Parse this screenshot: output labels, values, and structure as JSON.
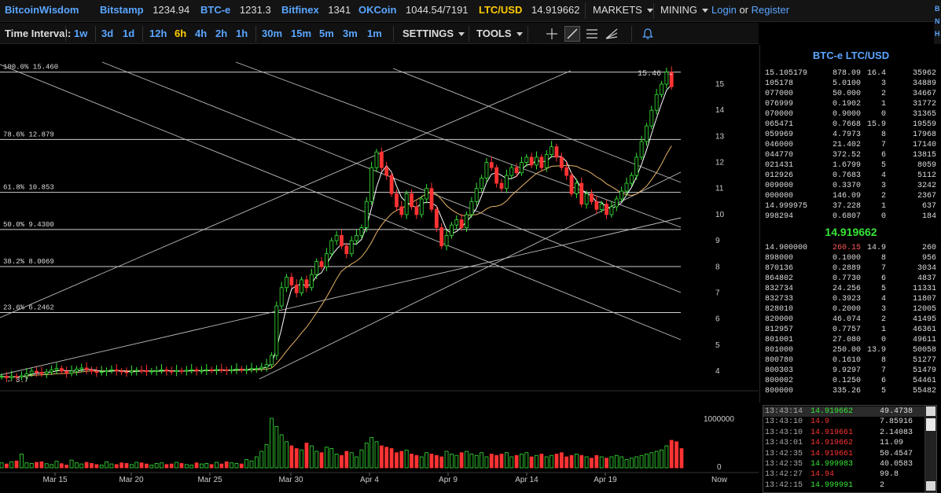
{
  "app": {
    "logo": "BitcoinWisdom"
  },
  "tickers": [
    {
      "exchange": "Bitstamp",
      "price": "1234.94"
    },
    {
      "exchange": "BTC-e",
      "price": "1231.3"
    },
    {
      "exchange": "Bitfinex",
      "price": "1341"
    },
    {
      "exchange": "OKCoin",
      "price": "1044.54/7191"
    },
    {
      "exchange": "LTC/USD",
      "price": "14.919662"
    }
  ],
  "topnav": {
    "markets": "MARKETS",
    "mining": "MINING",
    "login": "Login",
    "or": "or",
    "register": "Register"
  },
  "edge_letters": [
    "B",
    "N",
    "H"
  ],
  "toolbar": {
    "time_interval_label": "Time Interval:",
    "intervals": [
      "1w",
      "3d",
      "1d",
      "12h",
      "6h",
      "4h",
      "2h",
      "1h",
      "30m",
      "15m",
      "5m",
      "3m",
      "1m"
    ],
    "active_interval": "6h",
    "settings": "SETTINGS",
    "tools": "TOOLS",
    "tool_icons": [
      "crosshair-icon",
      "line-tool-icon",
      "horizontal-lines-icon",
      "fan-tool-icon",
      "bell-icon"
    ]
  },
  "colors": {
    "up": "#37e637",
    "down": "#ff3333",
    "link": "#5aa6ff",
    "pair": "#ffcc00"
  },
  "chart_data": {
    "type": "candlestick",
    "y_ticks": [
      4,
      5,
      6,
      7,
      8,
      9,
      10,
      11,
      12,
      13,
      14,
      15
    ],
    "ylim": [
      3.0,
      15.9
    ],
    "x_ticks": [
      "Mar 15",
      "Mar 20",
      "Mar 25",
      "Mar 30",
      "Apr 4",
      "Apr 9",
      "Apr 14",
      "Apr 19",
      "Now"
    ],
    "fib_levels": [
      {
        "label": "100.0% 15.460",
        "value": 15.46
      },
      {
        "label": "78.6% 12.879",
        "value": 12.879
      },
      {
        "label": "61.8% 10.853",
        "value": 10.853
      },
      {
        "label": "50.0% 9.4300",
        "value": 9.43
      },
      {
        "label": "38.2% 8.0069",
        "value": 8.0069
      },
      {
        "label": "23.6% 6.2462",
        "value": 6.2462
      }
    ],
    "high_marker": "15.46",
    "low_marker": "3.7",
    "volume_tick": "1000000",
    "volume_zero": "0",
    "closes": [
      3.8,
      3.75,
      3.8,
      3.78,
      3.82,
      3.9,
      4.0,
      3.95,
      3.9,
      3.97,
      4.05,
      4.1,
      4.0,
      3.92,
      4.0,
      4.08,
      4.12,
      4.05,
      4.0,
      3.95,
      3.98,
      4.02,
      4.05,
      4.0,
      3.97,
      3.95,
      4.0,
      4.03,
      4.02,
      3.98,
      4.0,
      4.02,
      4.05,
      4.0,
      3.98,
      4.02,
      4.0,
      4.03,
      4.05,
      4.0,
      4.02,
      4.05,
      4.03,
      4.06,
      4.05,
      4.02,
      4.05,
      4.08,
      4.05,
      4.06,
      4.1,
      4.1,
      4.15,
      4.25,
      4.6,
      6.5,
      7.2,
      7.6,
      7.3,
      7.0,
      7.5,
      7.2,
      7.7,
      8.2,
      8.0,
      8.5,
      9.0,
      9.2,
      8.8,
      8.5,
      9.0,
      9.2,
      9.5,
      10.5,
      11.8,
      12.4,
      11.8,
      11.5,
      10.8,
      10.3,
      10.0,
      10.8,
      10.3,
      10.0,
      10.6,
      11.0,
      10.2,
      9.5,
      8.8,
      9.2,
      9.6,
      9.8,
      9.5,
      10.0,
      10.5,
      11.0,
      11.4,
      12.0,
      11.8,
      11.2,
      11.0,
      11.5,
      11.8,
      11.6,
      12.0,
      12.2,
      11.9,
      12.2,
      11.8,
      12.3,
      12.6,
      12.2,
      11.8,
      11.5,
      10.8,
      11.2,
      10.4,
      10.8,
      10.5,
      10.2,
      10.4,
      10.0,
      10.3,
      10.6,
      10.9,
      11.2,
      11.5,
      12.2,
      12.8,
      13.4,
      14.0,
      14.6,
      15.0,
      15.46,
      14.9
    ],
    "volumes": [
      18,
      14,
      22,
      25,
      50,
      18,
      16,
      20,
      22,
      15,
      12,
      24,
      15,
      10,
      28,
      18,
      14,
      20,
      16,
      12,
      10,
      22,
      14,
      12,
      18,
      16,
      12,
      20,
      18,
      14,
      10,
      16,
      18,
      12,
      14,
      20,
      16,
      12,
      10,
      18,
      14,
      16,
      12,
      20,
      14,
      22,
      18,
      16,
      14,
      30,
      25,
      40,
      60,
      85,
      180,
      150,
      120,
      95,
      80,
      70,
      65,
      90,
      80,
      60,
      55,
      75,
      70,
      50,
      45,
      60,
      55,
      40,
      65,
      90,
      110,
      95,
      80,
      75,
      70,
      55,
      60,
      65,
      50,
      45,
      40,
      55,
      50,
      45,
      40,
      60,
      50,
      45,
      55,
      60,
      50,
      45,
      55,
      40,
      50,
      45,
      50,
      55,
      40,
      45,
      50,
      55,
      40,
      45,
      50,
      40,
      45,
      50,
      55,
      40,
      45,
      50,
      45,
      40,
      35,
      45,
      40,
      35,
      40,
      45,
      40,
      30,
      35,
      40,
      45,
      50,
      55,
      60,
      65,
      80,
      100,
      95,
      70
    ]
  },
  "orderbook": {
    "title": "BTC-e LTC/USD",
    "last_price": "14.919662",
    "asks": [
      [
        "15.105179",
        "878.09",
        "16.4",
        "35962"
      ],
      [
        "105178",
        "5.0100",
        "3",
        "34889"
      ],
      [
        "077000",
        "50.000",
        "2",
        "34667"
      ],
      [
        "076999",
        "0.1902",
        "1",
        "31772"
      ],
      [
        "070000",
        "0.9000",
        "0",
        "31365"
      ],
      [
        "065471",
        "0.7668",
        "15.9",
        "19559"
      ],
      [
        "059969",
        "4.7973",
        "8",
        "17968"
      ],
      [
        "046000",
        "21.402",
        "7",
        "17140"
      ],
      [
        "044770",
        "372.52",
        "6",
        "13815"
      ],
      [
        "021431",
        "1.6799",
        "5",
        "8059"
      ],
      [
        "012926",
        "0.7683",
        "4",
        "5112"
      ],
      [
        "009000",
        "0.3370",
        "3",
        "3242"
      ],
      [
        "000000",
        "146.09",
        "2",
        "2367"
      ],
      [
        "14.999975",
        "37.228",
        "1",
        "637"
      ],
      [
        "998294",
        "0.6807",
        "0",
        "184"
      ]
    ],
    "bids": [
      [
        "14.900000",
        "260.15",
        "14.9",
        "260"
      ],
      [
        "898000",
        "0.1000",
        "8",
        "956"
      ],
      [
        "870136",
        "0.2889",
        "7",
        "3034"
      ],
      [
        "864802",
        "0.7730",
        "6",
        "4837"
      ],
      [
        "832734",
        "24.256",
        "5",
        "11331"
      ],
      [
        "832733",
        "0.3923",
        "4",
        "11807"
      ],
      [
        "828010",
        "0.2000",
        "3",
        "12005"
      ],
      [
        "820000",
        "46.074",
        "2",
        "41495"
      ],
      [
        "812957",
        "0.7757",
        "1",
        "46361"
      ],
      [
        "801001",
        "27.080",
        "0",
        "49611"
      ],
      [
        "801000",
        "250.00",
        "13.9",
        "50058"
      ],
      [
        "800780",
        "0.1610",
        "8",
        "51277"
      ],
      [
        "800303",
        "9.9297",
        "7",
        "51479"
      ],
      [
        "800002",
        "0.1250",
        "6",
        "54461"
      ],
      [
        "800000",
        "335.26",
        "5",
        "55482"
      ]
    ]
  },
  "trades": [
    {
      "time": "13:43:14",
      "price": "14.919662",
      "amount": "49.4738",
      "side": "buy"
    },
    {
      "time": "13:43:10",
      "price": "14.9",
      "amount": "7.85916",
      "side": "sell"
    },
    {
      "time": "13:43:10",
      "price": "14.919661",
      "amount": "2.14083",
      "side": "sell"
    },
    {
      "time": "13:43:01",
      "price": "14.919662",
      "amount": "11.09",
      "side": "sell"
    },
    {
      "time": "13:42:35",
      "price": "14.919661",
      "amount": "50.4547",
      "side": "sell"
    },
    {
      "time": "13:42:35",
      "price": "14.999983",
      "amount": "40.0583",
      "side": "buy"
    },
    {
      "time": "13:42:27",
      "price": "14.94",
      "amount": "99.8",
      "side": "sell"
    },
    {
      "time": "13:42:15",
      "price": "14.999991",
      "amount": "2",
      "side": "buy"
    }
  ]
}
